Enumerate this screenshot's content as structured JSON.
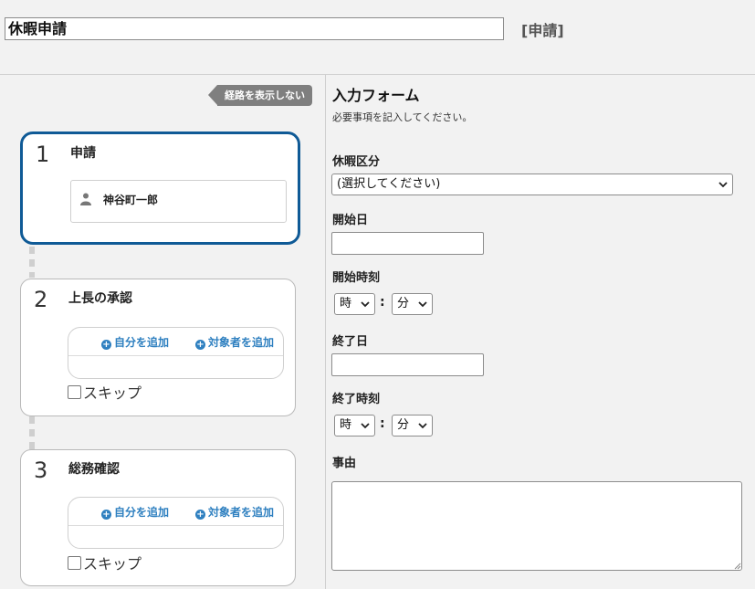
{
  "header": {
    "title_value": "休暇申請",
    "status": "[申請]"
  },
  "route": {
    "toggle_label": "経路を表示しない",
    "steps": [
      {
        "number": "1",
        "title": "申請",
        "assignee": "神谷町一郎"
      },
      {
        "number": "2",
        "title": "上長の承認",
        "add_self": "自分を追加",
        "add_target": "対象者を追加",
        "skip": "スキップ"
      },
      {
        "number": "3",
        "title": "総務確認",
        "add_self": "自分を追加",
        "add_target": "対象者を追加",
        "skip": "スキップ"
      }
    ]
  },
  "form": {
    "title": "入力フォーム",
    "note": "必要事項を記入してください。",
    "leave_type": {
      "label": "休暇区分",
      "selected": "(選択してください)"
    },
    "start_date": {
      "label": "開始日",
      "value": ""
    },
    "start_time": {
      "label": "開始時刻",
      "hour": "時",
      "minute": "分",
      "separator": ":"
    },
    "end_date": {
      "label": "終了日",
      "value": ""
    },
    "end_time": {
      "label": "終了時刻",
      "hour": "時",
      "minute": "分",
      "separator": ":"
    },
    "reason": {
      "label": "事由",
      "value": ""
    }
  },
  "colors": {
    "active_border": "#0f5a96",
    "link": "#2f80c0",
    "toggle_bg": "#7f7f7f"
  }
}
